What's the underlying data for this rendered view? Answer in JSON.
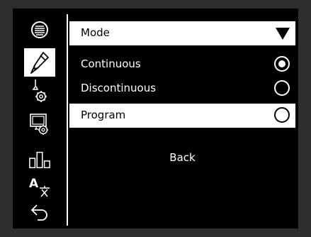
{
  "sidebar": {
    "items": [
      {
        "icon": "spool-icon"
      },
      {
        "icon": "torch-icon",
        "selected": true
      },
      {
        "icon": "torch-settings-icon"
      },
      {
        "icon": "screen-settings-icon"
      },
      {
        "icon": "bar-chart-icon"
      },
      {
        "icon": "language-icon"
      },
      {
        "icon": "return-icon"
      }
    ]
  },
  "menu": {
    "header": {
      "label": "Mode"
    },
    "options": [
      {
        "label": "Continuous",
        "checked": true
      },
      {
        "label": "Discontinuous",
        "checked": false
      },
      {
        "label": "Program",
        "checked": false,
        "highlighted": true
      }
    ],
    "back_label": "Back"
  },
  "colors": {
    "background": "#000000",
    "foreground": "#ffffff",
    "bezel": "#2d2d2d"
  }
}
